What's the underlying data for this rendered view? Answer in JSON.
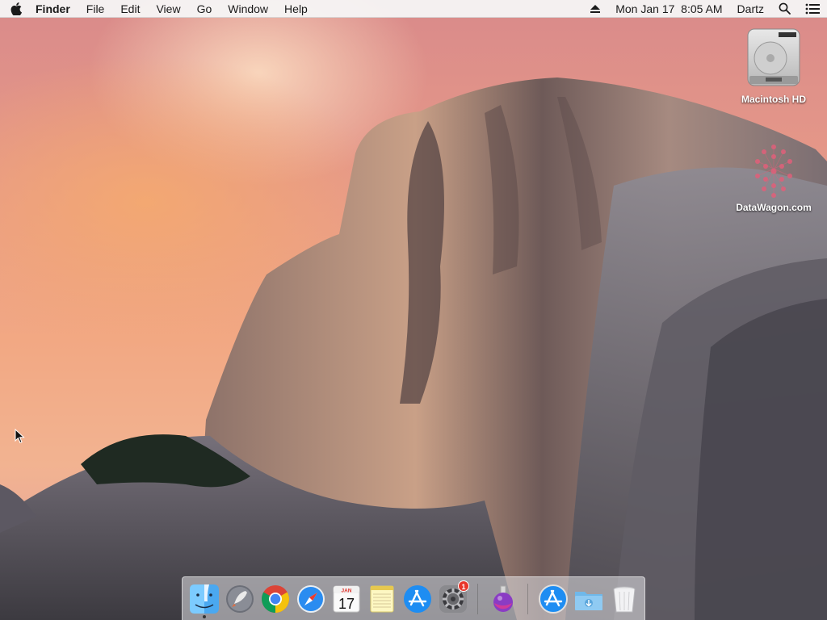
{
  "menubar": {
    "app_name": "Finder",
    "menus": [
      "File",
      "Edit",
      "View",
      "Go",
      "Window",
      "Help"
    ],
    "clock": "Mon Jan 17  8:05 AM",
    "user": "Dartz"
  },
  "desktop": {
    "icons": [
      {
        "label": "Macintosh HD",
        "icon": "hard-drive-icon"
      },
      {
        "label": "DataWagon.com",
        "icon": "datawagon-logo-icon"
      }
    ]
  },
  "dock": {
    "items": [
      {
        "name": "Finder",
        "icon": "finder-icon",
        "running": true
      },
      {
        "name": "Launchpad",
        "icon": "launchpad-icon"
      },
      {
        "name": "Google Chrome",
        "icon": "chrome-icon"
      },
      {
        "name": "Safari",
        "icon": "safari-icon"
      },
      {
        "name": "Calendar",
        "icon": "calendar-icon"
      },
      {
        "name": "Notes",
        "icon": "notes-icon"
      },
      {
        "name": "App Store",
        "icon": "app-store-icon"
      },
      {
        "name": "System Preferences",
        "icon": "system-preferences-icon"
      },
      {
        "name": "Potion app",
        "icon": "potion-icon"
      },
      {
        "name": "Applications",
        "icon": "applications-folder-icon"
      },
      {
        "name": "Downloads",
        "icon": "downloads-folder-icon"
      },
      {
        "name": "Trash",
        "icon": "trash-icon"
      }
    ],
    "calendar_month": "JAN",
    "calendar_day": "17",
    "system_prefs_badge": "1"
  },
  "colors": {
    "menubar_bg": "#f6f6f6",
    "badge_red": "#e8362b",
    "sky_pink": "#e79a88"
  }
}
